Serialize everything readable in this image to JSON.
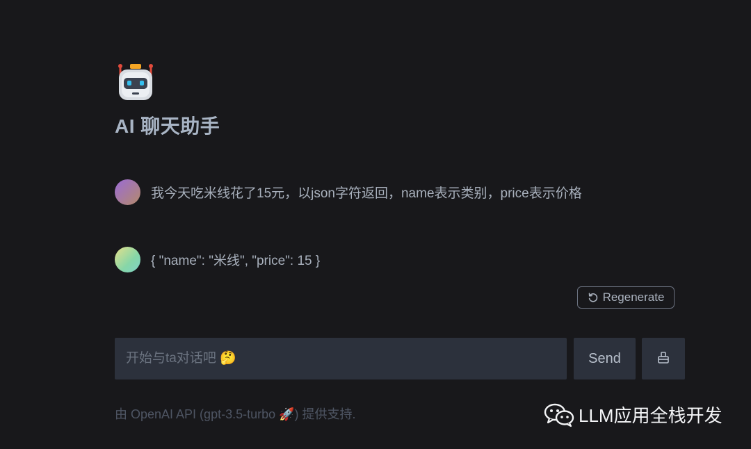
{
  "header": {
    "title": "AI 聊天助手",
    "logo_icon": "robot-icon"
  },
  "messages": [
    {
      "role": "user",
      "text": "我今天吃米线花了15元，以json字符返回，name表示类别，price表示价格"
    },
    {
      "role": "assistant",
      "text": "{ \"name\": \"米线\", \"price\": 15 }"
    }
  ],
  "actions": {
    "regenerate_label": "Regenerate",
    "regenerate_icon": "refresh-icon"
  },
  "composer": {
    "placeholder": "开始与ta对话吧 🤔",
    "value": "",
    "send_label": "Send",
    "clear_icon": "broom-icon"
  },
  "footer": {
    "text": "由 OpenAI API (gpt-3.5-turbo 🚀) 提供支持."
  },
  "watermark": {
    "text": "LLM应用全栈开发",
    "icon": "wechat-icon"
  },
  "colors": {
    "background": "#18181b",
    "input_bg": "#2c313c",
    "title": "#a8b4c4"
  }
}
